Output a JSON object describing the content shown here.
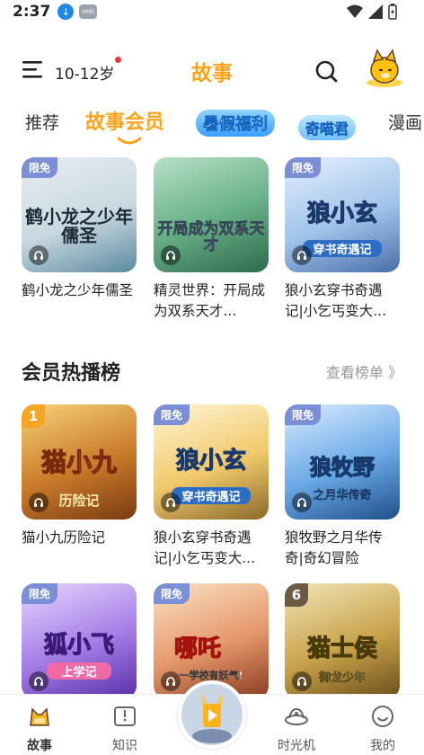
{
  "status_bar": {
    "time": "2:37",
    "notif_hms": "HMS"
  },
  "header": {
    "age_range": "10-12岁",
    "title": "故事"
  },
  "tabs": [
    {
      "label": "推荐"
    },
    {
      "label": "故事会员"
    },
    {
      "label": "暑假福利"
    },
    {
      "label": "奇喵君"
    },
    {
      "label": "漫画"
    }
  ],
  "top_cards": [
    {
      "tag": "限免",
      "cover_title": "鹤小龙之少年儒圣",
      "cover_sub": "",
      "title": "鹤小龙之少年儒圣"
    },
    {
      "tag": "",
      "cover_title": "开局成为双系天才",
      "cover_sub": "",
      "title": "精灵世界：开局成为双系天才..."
    },
    {
      "tag": "限免",
      "cover_title": "狼小玄",
      "cover_sub": "穿书奇遇记",
      "title": "狼小玄穿书奇遇记|小乞丐变大..."
    }
  ],
  "section": {
    "title": "会员热播榜",
    "more": "查看榜单 》"
  },
  "rank_cards": [
    {
      "rank": "1",
      "tag": "",
      "cover_title": "猫小九",
      "cover_sub": "历险记",
      "title": "猫小九历险记"
    },
    {
      "rank": "",
      "tag": "限免",
      "cover_title": "狼小玄",
      "cover_sub": "穿书奇遇记",
      "title": "狼小玄穿书奇遇记|小乞丐变大..."
    },
    {
      "rank": "",
      "tag": "限免",
      "cover_title": "狼牧野",
      "cover_sub": "之月华传奇",
      "title": "狼牧野之月华传奇|奇幻冒险"
    },
    {
      "rank": "",
      "tag": "限免",
      "cover_title": "狐小飞",
      "cover_sub": "上学记",
      "title": ""
    },
    {
      "rank": "",
      "tag": "限免",
      "cover_title": "哪吒",
      "cover_sub": "一学校有妖气!",
      "title": ""
    },
    {
      "rank": "6",
      "tag": "",
      "cover_title": "猫士侯",
      "cover_sub": "御龙少年",
      "title": ""
    }
  ],
  "bottom_nav": [
    {
      "label": "故事",
      "icon": "fox-story-icon"
    },
    {
      "label": "知识",
      "icon": "book-icon"
    },
    {
      "label": "",
      "icon": "play-icon"
    },
    {
      "label": "时光机",
      "icon": "time-machine-icon"
    },
    {
      "label": "我的",
      "icon": "profile-icon"
    }
  ],
  "colors": {
    "accent": "#ffa31a",
    "tag": "#7b8fd6",
    "age_dot": "#e53935"
  }
}
